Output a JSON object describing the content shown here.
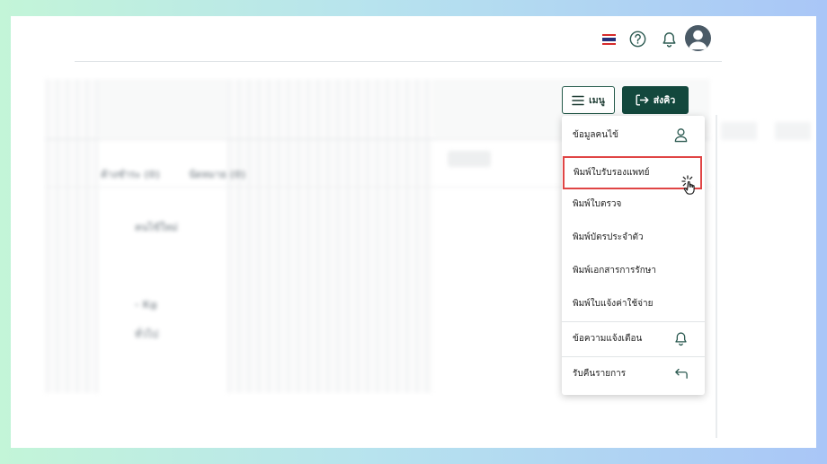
{
  "header": {
    "flag_icon": "thai-flag-icon",
    "help_icon": "help-circle-icon",
    "notification_icon": "bell-icon",
    "avatar_icon": "user-avatar-icon"
  },
  "background": {
    "tab_pending": "ค้างชำระ (0)",
    "tab_appointment": "นัดหมาย (0)",
    "new_patient": "คนไข้ใหม่",
    "weight": "- Kg",
    "general": "ทั่วไป"
  },
  "toolbar": {
    "menu_label": "เมนู",
    "send_label": "ส่งคิว"
  },
  "menu": {
    "items": [
      {
        "label": "ข้อมูลคนไข้",
        "icon": "user-icon"
      },
      {
        "label": "พิมพ์ใบรับรองแพทย์",
        "icon": "",
        "highlighted": true
      },
      {
        "label": "พิมพ์ใบตรวจ",
        "icon": ""
      },
      {
        "label": "พิมพ์บัตรประจำตัว",
        "icon": ""
      },
      {
        "label": "พิมพ์เอกสารการรักษา",
        "icon": ""
      },
      {
        "label": "พิมพ์ใบแจ้งค่าใช้จ่าย",
        "icon": ""
      },
      {
        "label": "ข้อความแจ้งเตือน",
        "icon": "bell-icon"
      },
      {
        "label": "รับคืนรายการ",
        "icon": "return-arrow-icon"
      }
    ]
  },
  "colors": {
    "primary": "#13483d",
    "highlight": "#e04545"
  }
}
